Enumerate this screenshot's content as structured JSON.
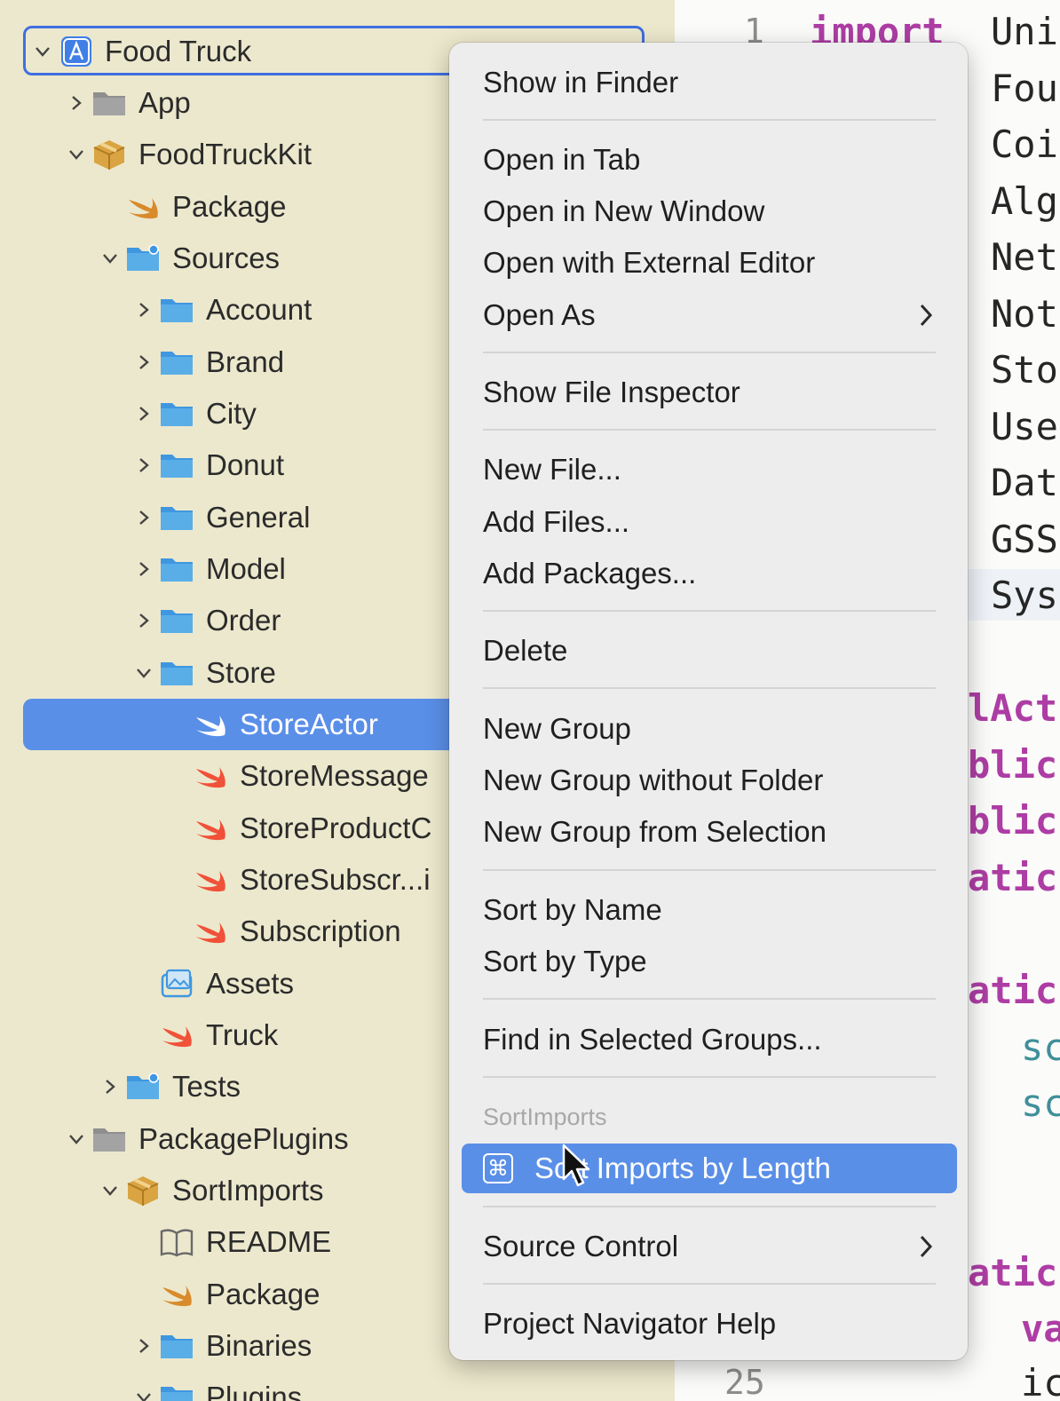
{
  "navigator": {
    "items": [
      {
        "label": "Food Truck"
      },
      {
        "label": "App"
      },
      {
        "label": "FoodTruckKit"
      },
      {
        "label": "Package"
      },
      {
        "label": "Sources"
      },
      {
        "label": "Account"
      },
      {
        "label": "Brand"
      },
      {
        "label": "City"
      },
      {
        "label": "Donut"
      },
      {
        "label": "General"
      },
      {
        "label": "Model"
      },
      {
        "label": "Order"
      },
      {
        "label": "Store"
      },
      {
        "label": "StoreActor"
      },
      {
        "label": "StoreMessage"
      },
      {
        "label": "StoreProductC"
      },
      {
        "label": "StoreSubscr...i"
      },
      {
        "label": "Subscription"
      },
      {
        "label": "Assets"
      },
      {
        "label": "Truck"
      },
      {
        "label": "Tests"
      },
      {
        "label": "PackagePlugins"
      },
      {
        "label": "SortImports"
      },
      {
        "label": "README"
      },
      {
        "label": "Package"
      },
      {
        "label": "Binaries"
      },
      {
        "label": "Plugins"
      }
    ]
  },
  "editor": {
    "lines": [
      {
        "num": "1",
        "keyword": "import",
        "text": "Uni"
      },
      {
        "text": "Fou"
      },
      {
        "text": "Coi"
      },
      {
        "text": "Alg"
      },
      {
        "text": "Net"
      },
      {
        "text": "Not"
      },
      {
        "text": "Sto"
      },
      {
        "text": "Use"
      },
      {
        "text": "Dat"
      },
      {
        "text": "GSS"
      },
      {
        "text": "Sys"
      },
      {
        "keyword": "lAct"
      },
      {
        "keyword": "blic"
      },
      {
        "keyword": "blic"
      },
      {
        "keyword": "atic"
      },
      {
        "keyword": "atic"
      },
      {
        "text": "sc"
      },
      {
        "text": "sc"
      },
      {
        "keyword": "atic"
      },
      {
        "text": "va"
      },
      {
        "num": "25",
        "text": "ic"
      }
    ]
  },
  "context_menu": {
    "show_in_finder": "Show in Finder",
    "open_in_tab": "Open in Tab",
    "open_in_new_window": "Open in New Window",
    "open_with_external_editor": "Open with External Editor",
    "open_as": "Open As",
    "show_file_inspector": "Show File Inspector",
    "new_file": "New File...",
    "add_files": "Add Files...",
    "add_packages": "Add Packages...",
    "delete": "Delete",
    "new_group": "New Group",
    "new_group_without_folder": "New Group without Folder",
    "new_group_from_selection": "New Group from Selection",
    "sort_by_name": "Sort by Name",
    "sort_by_type": "Sort by Type",
    "find_in_selected_groups": "Find in Selected Groups...",
    "plugin_header": "SortImports",
    "sort_imports_by_length": "Sort Imports by Length",
    "command_symbol": "⌘",
    "source_control": "Source Control",
    "project_navigator_help": "Project Navigator Help"
  },
  "colors": {
    "selection": "#5a8fe8",
    "folder": "#5aaee8",
    "swift": "#f05138",
    "keyword": "#ad3da4"
  }
}
